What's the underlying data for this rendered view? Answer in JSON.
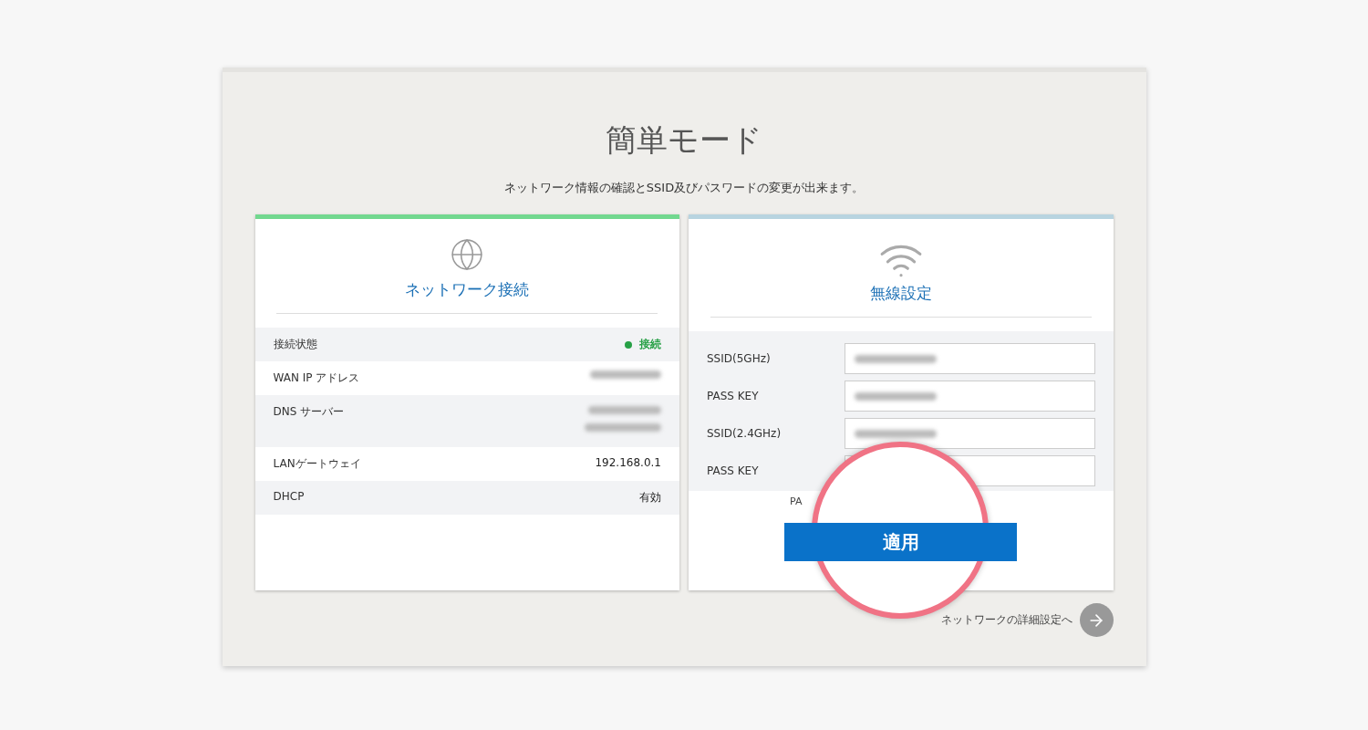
{
  "title": "簡単モード",
  "subtitle": "ネットワーク情報の確認とSSID及びパスワードの変更が出来ます。",
  "cards": [
    {
      "kind": "info",
      "color": "#72d88f",
      "title": "ネットワーク接続",
      "rows": [
        {
          "kind": "status",
          "label": "接続状態",
          "value": "接続"
        },
        {
          "kind": "blurred",
          "label": "WAN IP アドレス"
        },
        {
          "kind": "blurred_pair",
          "label": "DNS サーバー"
        },
        {
          "kind": "text",
          "label": "LANゲートウェイ",
          "value": "192.168.0.1"
        },
        {
          "kind": "text",
          "label": "DHCP",
          "value": "有効"
        }
      ]
    },
    {
      "kind": "form",
      "color": "#b8d4e0",
      "title": "無線設定",
      "fields": [
        {
          "label": "SSID(5GHz)",
          "blurred": true
        },
        {
          "label": "PASS KEY",
          "blurred": true
        },
        {
          "label": "SSID(2.4GHz)",
          "blurred": true
        },
        {
          "label": "PASS KEY"
        }
      ],
      "note": "PA",
      "button": "適用"
    }
  ],
  "link": "ネットワークの詳細設定へ"
}
